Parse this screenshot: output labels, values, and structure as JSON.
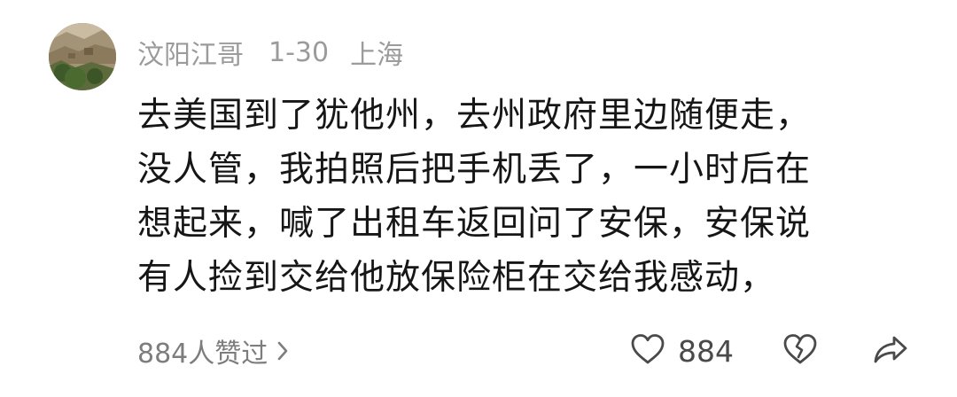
{
  "comment": {
    "author": "汶阳江哥",
    "date": "1-30",
    "location": "上海",
    "lines": [
      "去美国到了犹他州，去州政府里边随便走，",
      "没人管，我拍照后把手机丢了，一小时后在",
      "想起来，喊了出租车返回问了安保，安保说",
      "有人捡到交给他放保险柜在交给我感动，"
    ],
    "likes_summary": "884人赞过",
    "like_count": "884"
  },
  "icons": {
    "avatar": "avatar-photo",
    "likes_chevron": "chevron-right-icon",
    "like": "heart-outline-icon",
    "dislike": "broken-heart-icon",
    "share": "share-arrow-icon"
  },
  "colors": {
    "text_primary": "#161616",
    "text_secondary": "#9b9b9b",
    "icon": "#4a4a4a",
    "background": "#ffffff"
  }
}
